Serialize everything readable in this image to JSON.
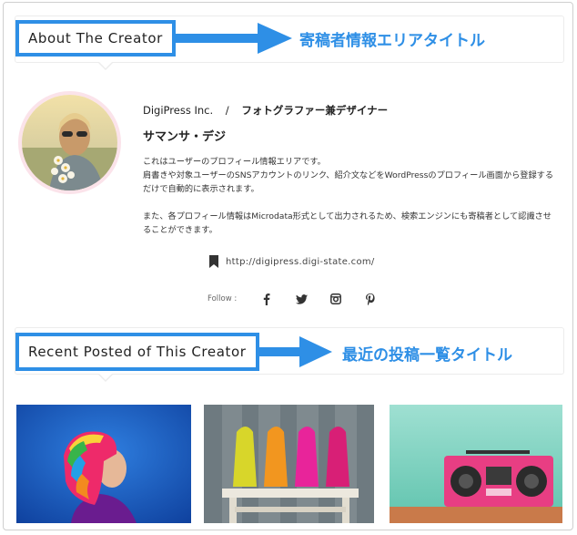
{
  "about_section": {
    "title": "About The Creator",
    "callout": "寄稿者情報エリアタイトル"
  },
  "author": {
    "organization": "DigiPress Inc.",
    "separator": "/",
    "role": "フォトグラファー兼デザイナー",
    "name": "サマンサ・デジ",
    "bio_paragraphs": [
      "これはユーザーのプロフィール情報エリアです。\n肩書きや対象ユーザーのSNSアカウントのリンク、紹介文などをWordPressのプロフィール画面から登録する\nだけで自動的に表示されます。",
      "また、各プロフィール情報はMicrodata形式として出力されるため、検索エンジンにも寄稿者として認識させ\nることができます。"
    ],
    "url": "http://digipress.digi-state.com/",
    "follow_label": "Follow :",
    "social": [
      {
        "icon": "facebook-icon",
        "glyph": "f"
      },
      {
        "icon": "twitter-icon",
        "glyph": ""
      },
      {
        "icon": "instagram-icon",
        "glyph": ""
      },
      {
        "icon": "pinterest-icon",
        "glyph": "p"
      }
    ]
  },
  "recent_section": {
    "title": "Recent Posted of This Creator",
    "callout": "最近の投稿一覧タイトル"
  },
  "posts": [
    {
      "icon": "post-thumbnail-rainbow-hair"
    },
    {
      "icon": "post-thumbnail-colorful-heels"
    },
    {
      "icon": "post-thumbnail-pink-boombox"
    }
  ],
  "colors": {
    "accent": "#2e8fe6",
    "avatar_ring": "#fbe3ea"
  }
}
